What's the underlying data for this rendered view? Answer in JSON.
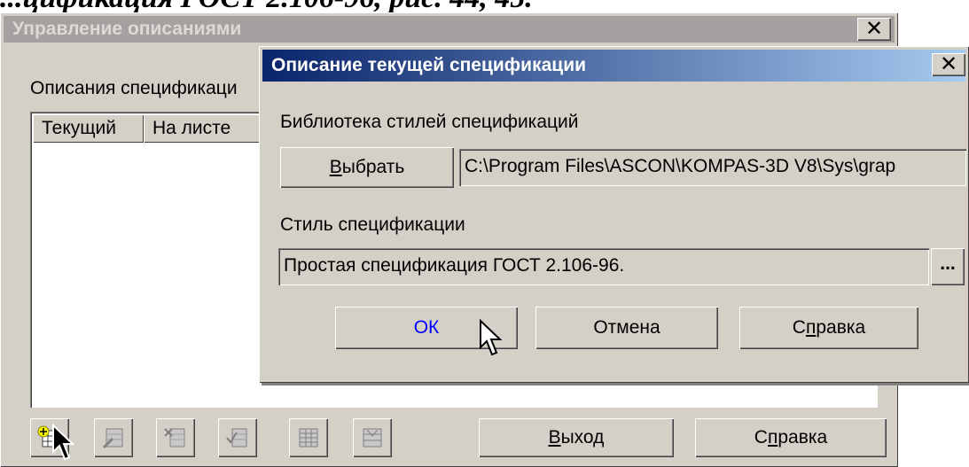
{
  "doc_heading": {
    "text": "...цификация ГОСТ 2.106-96, рис. 44, 45."
  },
  "outer_dialog": {
    "title": "Управление описаниями",
    "close_glyph": "✕",
    "label": "Описания спецификаци",
    "columns": [
      "Текущий",
      "На листе"
    ],
    "toolbar_icons": [
      "add-spec-icon",
      "edit-spec-icon",
      "delete-spec-icon",
      "check-spec-icon",
      "table-icon",
      "sheet-icon"
    ],
    "exit_button": {
      "prefix": "",
      "accel": "В",
      "rest": "ыход"
    },
    "help_button": {
      "prefix": "С",
      "accel": "п",
      "rest": "равка"
    }
  },
  "inner_dialog": {
    "title": "Описание текущей спецификации",
    "close_glyph": "✕",
    "library_label": "Библиотека  стилей спецификаций",
    "choose_button": {
      "prefix": "",
      "accel": "В",
      "rest": "ыбрать"
    },
    "library_path": "C:\\Program Files\\ASCON\\KOMPAS-3D V8\\Sys\\grap",
    "style_label": "Стиль спецификации",
    "style_value": "Простая спецификация ГОСТ 2.106-96.",
    "browse_button": "...",
    "ok_button": "ОК",
    "cancel_button": "Отмена",
    "help_button": {
      "prefix": "С",
      "accel": "п",
      "rest": "равка"
    }
  },
  "colors": {
    "dialog_bg": "#d4d0c8",
    "active_title_start": "#0a246a",
    "active_title_end": "#a6caf0",
    "inactive_title": "#a4a1a0",
    "ok_text": "#0000ff"
  }
}
